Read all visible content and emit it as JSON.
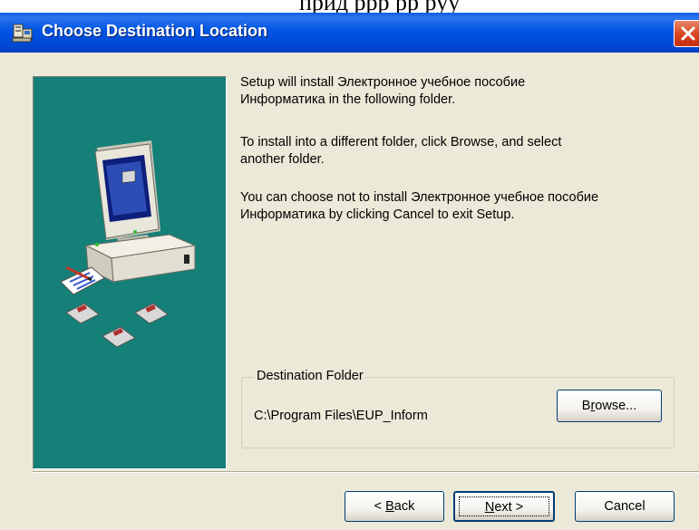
{
  "window": {
    "title": "Choose Destination Location"
  },
  "body": {
    "para1_line1": "Setup will install Электронное учебное пособие",
    "para1_line2": "Информатика in the following folder.",
    "para2_line1": "To install into a different folder, click Browse, and select",
    "para2_line2": "another folder.",
    "para3_line1": "You can choose not to install Электронное учебное пособие",
    "para3_line2": "Информатика by clicking Cancel to exit Setup."
  },
  "destination": {
    "group_label": "Destination Folder",
    "path": "C:\\Program Files\\EUP_Inform",
    "browse_label_pre": "B",
    "browse_label_u": "r",
    "browse_label_post": "owse..."
  },
  "buttons": {
    "back_prefix": "< ",
    "back_u": "B",
    "back_rest": "ack",
    "next_u": "N",
    "next_rest": "ext >",
    "cancel": "Cancel"
  },
  "icons": [
    "installer-icon",
    "close-icon",
    "computer-icon",
    "disk-icon",
    "notepad-icon"
  ]
}
